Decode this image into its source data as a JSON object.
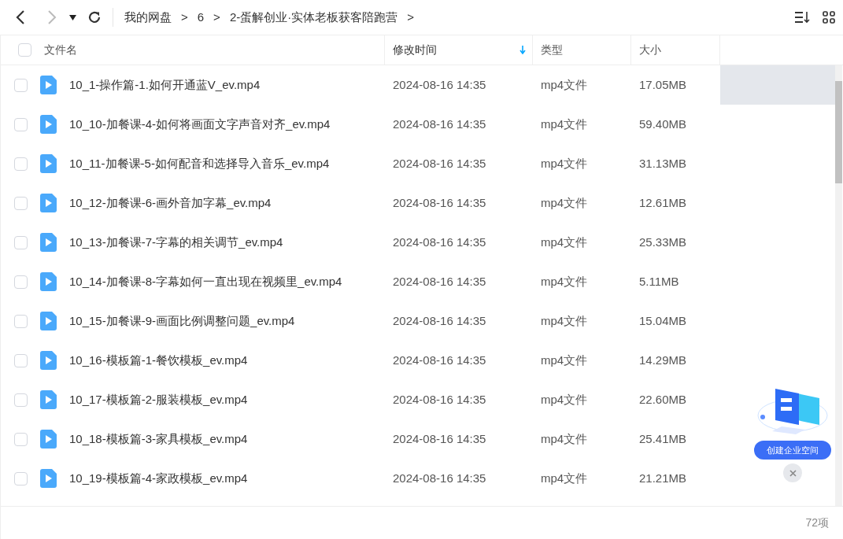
{
  "breadcrumb": [
    "我的网盘",
    "6",
    "2-蛋解创业·实体老板获客陪跑营"
  ],
  "separator": ">",
  "select_all_checked": false,
  "columns": [
    {
      "label": "文件名",
      "sorted": false
    },
    {
      "label": "修改时间",
      "sorted": true
    },
    {
      "label": "类型",
      "sorted": false
    },
    {
      "label": "大小",
      "sorted": false
    }
  ],
  "rows": [
    {
      "name": "10_1-操作篇-1.如何开通蓝V_ev.mp4",
      "modified": "2024-08-16 14:35",
      "type": "mp4文件",
      "size": "17.05MB",
      "checked": false,
      "hovered": true
    },
    {
      "name": "10_10-加餐课-4-如何将画面文字声音对齐_ev.mp4",
      "modified": "2024-08-16 14:35",
      "type": "mp4文件",
      "size": "59.40MB",
      "checked": false,
      "hovered": false
    },
    {
      "name": "10_11-加餐课-5-如何配音和选择导入音乐_ev.mp4",
      "modified": "2024-08-16 14:35",
      "type": "mp4文件",
      "size": "31.13MB",
      "checked": false,
      "hovered": false
    },
    {
      "name": "10_12-加餐课-6-画外音加字幕_ev.mp4",
      "modified": "2024-08-16 14:35",
      "type": "mp4文件",
      "size": "12.61MB",
      "checked": false,
      "hovered": false
    },
    {
      "name": "10_13-加餐课-7-字幕的相关调节_ev.mp4",
      "modified": "2024-08-16 14:35",
      "type": "mp4文件",
      "size": "25.33MB",
      "checked": false,
      "hovered": false
    },
    {
      "name": "10_14-加餐课-8-字幕如何一直出现在视频里_ev.mp4",
      "modified": "2024-08-16 14:35",
      "type": "mp4文件",
      "size": "5.11MB",
      "checked": false,
      "hovered": false
    },
    {
      "name": "10_15-加餐课-9-画面比例调整问题_ev.mp4",
      "modified": "2024-08-16 14:35",
      "type": "mp4文件",
      "size": "15.04MB",
      "checked": false,
      "hovered": false
    },
    {
      "name": "10_16-模板篇-1-餐饮模板_ev.mp4",
      "modified": "2024-08-16 14:35",
      "type": "mp4文件",
      "size": "14.29MB",
      "checked": false,
      "hovered": false
    },
    {
      "name": "10_17-模板篇-2-服装模板_ev.mp4",
      "modified": "2024-08-16 14:35",
      "type": "mp4文件",
      "size": "22.60MB",
      "checked": false,
      "hovered": false
    },
    {
      "name": "10_18-模板篇-3-家具模板_ev.mp4",
      "modified": "2024-08-16 14:35",
      "type": "mp4文件",
      "size": "25.41MB",
      "checked": false,
      "hovered": false
    },
    {
      "name": "10_19-模板篇-4-家政模板_ev.mp4",
      "modified": "2024-08-16 14:35",
      "type": "mp4文件",
      "size": "21.21MB",
      "checked": false,
      "hovered": false
    }
  ],
  "promo": {
    "button": "创建企业空间"
  },
  "footer": {
    "count": "72项"
  }
}
